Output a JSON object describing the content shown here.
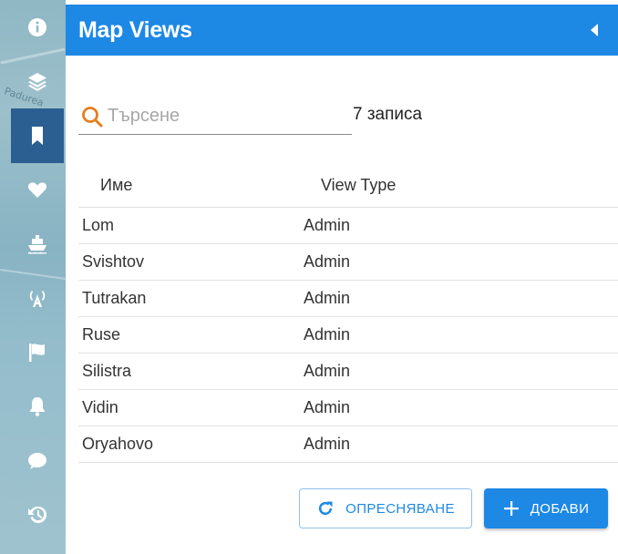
{
  "map": {
    "label": "Padurea"
  },
  "rail": {
    "items": [
      {
        "icon": "info-icon",
        "active": false
      },
      {
        "icon": "layers-icon",
        "active": false
      },
      {
        "icon": "bookmark-icon",
        "active": true
      },
      {
        "icon": "heart-icon",
        "active": false
      },
      {
        "icon": "ship-icon",
        "active": false
      },
      {
        "icon": "antenna-icon",
        "active": false
      },
      {
        "icon": "flag-icon",
        "active": false
      },
      {
        "icon": "bell-icon",
        "active": false
      },
      {
        "icon": "chat-icon",
        "active": false
      },
      {
        "icon": "history-icon",
        "active": false
      }
    ]
  },
  "panel": {
    "title": "Map Views",
    "search": {
      "placeholder": "Търсене",
      "value": ""
    },
    "record_count": "7 записа",
    "table": {
      "headers": [
        "Име",
        "View Type"
      ],
      "rows": [
        [
          "Lom",
          "Admin"
        ],
        [
          "Svishtov",
          "Admin"
        ],
        [
          "Tutrakan",
          "Admin"
        ],
        [
          "Ruse",
          "Admin"
        ],
        [
          "Silistra",
          "Admin"
        ],
        [
          "Vidin",
          "Admin"
        ],
        [
          "Oryahovo",
          "Admin"
        ]
      ]
    },
    "buttons": {
      "refresh": "ОПРЕСНЯВАНЕ",
      "add": "ДОБАВИ"
    }
  },
  "colors": {
    "primary": "#1e88e5",
    "rail_active": "#2c5f91",
    "search_icon": "#e67e22"
  }
}
